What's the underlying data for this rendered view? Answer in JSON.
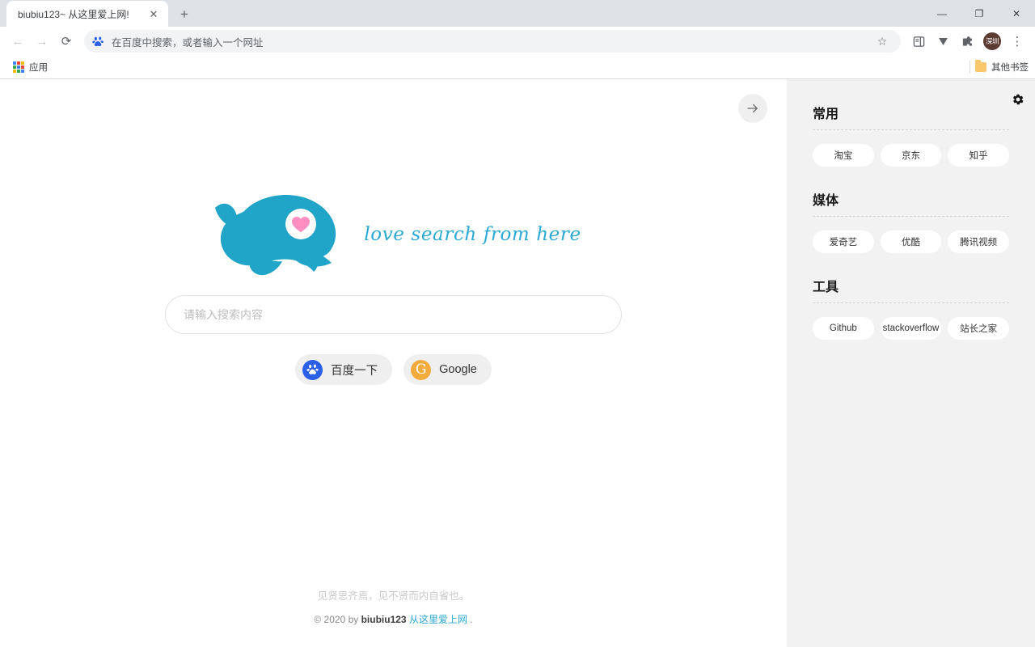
{
  "browser": {
    "tab": {
      "title": "biubiu123~ 从这里爱上网!",
      "close_label": "✕"
    },
    "new_tab_label": "+",
    "window_controls": {
      "minimize": "—",
      "maximize": "❐",
      "close": "✕"
    },
    "nav": {
      "back": "←",
      "forward": "→",
      "reload": "⟳"
    },
    "omnibox": {
      "placeholder": "在百度中搜索，或者输入一个网址",
      "star": "☆"
    },
    "toolbar_icons": [
      "side-panel-icon",
      "download-icon",
      "extensions-icon"
    ],
    "profile": {
      "initials": "深圳"
    },
    "menu_label": "⋮",
    "bookmarks": {
      "apps_label": "应用",
      "other_label": "其他书签"
    }
  },
  "page": {
    "toggle_sidebar_label": "→",
    "logo": {
      "tagline": "love search from here",
      "heart_color": "#ff8fc0",
      "whale_color": "#20a5c8"
    },
    "search": {
      "placeholder": "请输入搜索内容",
      "value": ""
    },
    "engines": [
      {
        "name": "baidu",
        "label": "百度一下",
        "icon": "baidu-paw-icon",
        "color": "#2b5fe8"
      },
      {
        "name": "google",
        "label": "Google",
        "icon": "google-g-icon",
        "color": "#f2ab3c"
      }
    ],
    "footer": {
      "quote": "见贤思齐焉，见不贤而内自省也。",
      "copyright_prefix": "© 2020 by ",
      "copyright_brand": "biubiu123",
      "copyright_link": " 从这里爱上网",
      "copyright_suffix": " ."
    }
  },
  "sidebar": {
    "settings_icon": "gear-icon",
    "sections": [
      {
        "title": "常用",
        "links": [
          {
            "label": "淘宝"
          },
          {
            "label": "京东"
          },
          {
            "label": "知乎"
          }
        ]
      },
      {
        "title": "媒体",
        "links": [
          {
            "label": "爱奇艺"
          },
          {
            "label": "优酷"
          },
          {
            "label": "腾讯视频"
          }
        ]
      },
      {
        "title": "工具",
        "links": [
          {
            "label": "Github"
          },
          {
            "label": "stackoverflow"
          },
          {
            "label": "站长之家"
          }
        ]
      }
    ]
  }
}
